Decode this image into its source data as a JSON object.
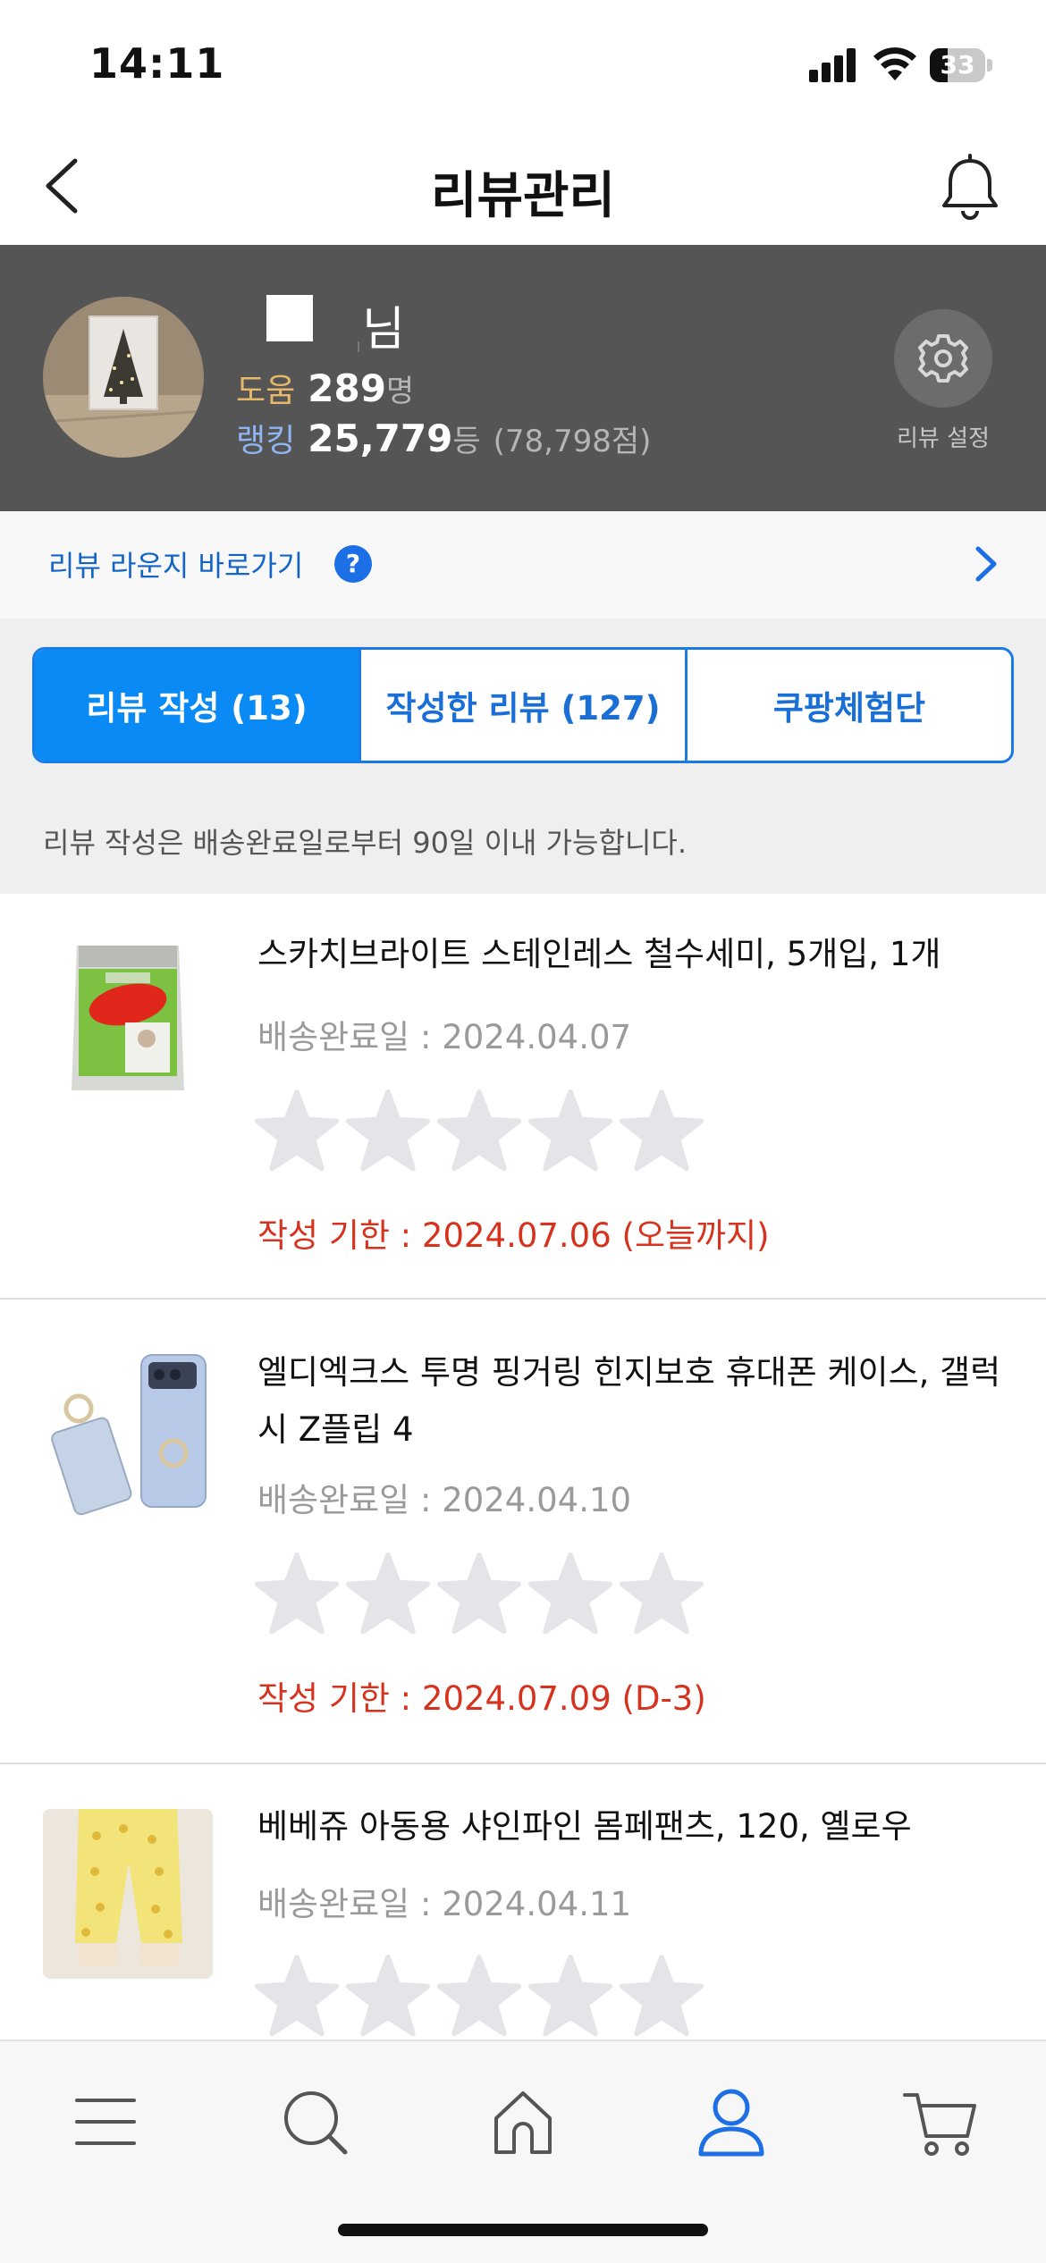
{
  "status_bar": {
    "time": "14:11",
    "battery": "33",
    "battery_level": 0.33
  },
  "header": {
    "title": "리뷰관리",
    "back_icon": "chevron-left-icon",
    "bell_icon": "bell-icon"
  },
  "profile": {
    "name_suffix": "님",
    "help_label": "도움",
    "help_value": "289",
    "help_unit": "명",
    "rank_label": "랭킹",
    "rank_value": "25,779",
    "rank_unit": "등",
    "rank_points": "(78,798점)",
    "settings_label": "리뷰 설정",
    "settings_icon": "gear-icon",
    "colors": {
      "background": "#555555",
      "help_label": "#e8b86a",
      "rank_label": "#8fb6f0"
    }
  },
  "lounge": {
    "label": "리뷰 라운지 바로가기",
    "help_badge": "?",
    "chevron_icon": "chevron-right-icon"
  },
  "tabs": [
    {
      "label": "리뷰 작성 (13)",
      "active": true
    },
    {
      "label": "작성한 리뷰 (127)",
      "active": false
    },
    {
      "label": "쿠팡체험단",
      "active": false
    }
  ],
  "notice": "리뷰 작성은 배송완료일로부터 90일 이내 가능합니다.",
  "products": [
    {
      "name": "스카치브라이트 스테인레스 철수세미, 5개입, 1개",
      "delivery": "배송완료일 : 2024.04.07",
      "rating": 0,
      "deadline": "작성 기한 : 2024.07.06 (오늘까지)"
    },
    {
      "name": "엘디엑크스 투명 핑거링 힌지보호 휴대폰 케이스, 갤럭시 Z플립 4",
      "delivery": "배송완료일 : 2024.04.10",
      "rating": 0,
      "deadline": "작성 기한 : 2024.07.09 (D-3)"
    },
    {
      "name": "베베쥬 아동용 샤인파인 몸페팬츠, 120, 옐로우",
      "delivery": "배송완료일 : 2024.04.11",
      "rating": 0
    }
  ],
  "bottom_nav": [
    {
      "icon": "menu-icon",
      "active": false
    },
    {
      "icon": "search-icon",
      "active": false
    },
    {
      "icon": "home-icon",
      "active": false
    },
    {
      "icon": "user-icon",
      "active": true
    },
    {
      "icon": "cart-icon",
      "active": false
    }
  ],
  "colors": {
    "accent": "#0a8af5",
    "deadline": "#d6321e",
    "star_empty": "#e3e5e9"
  }
}
